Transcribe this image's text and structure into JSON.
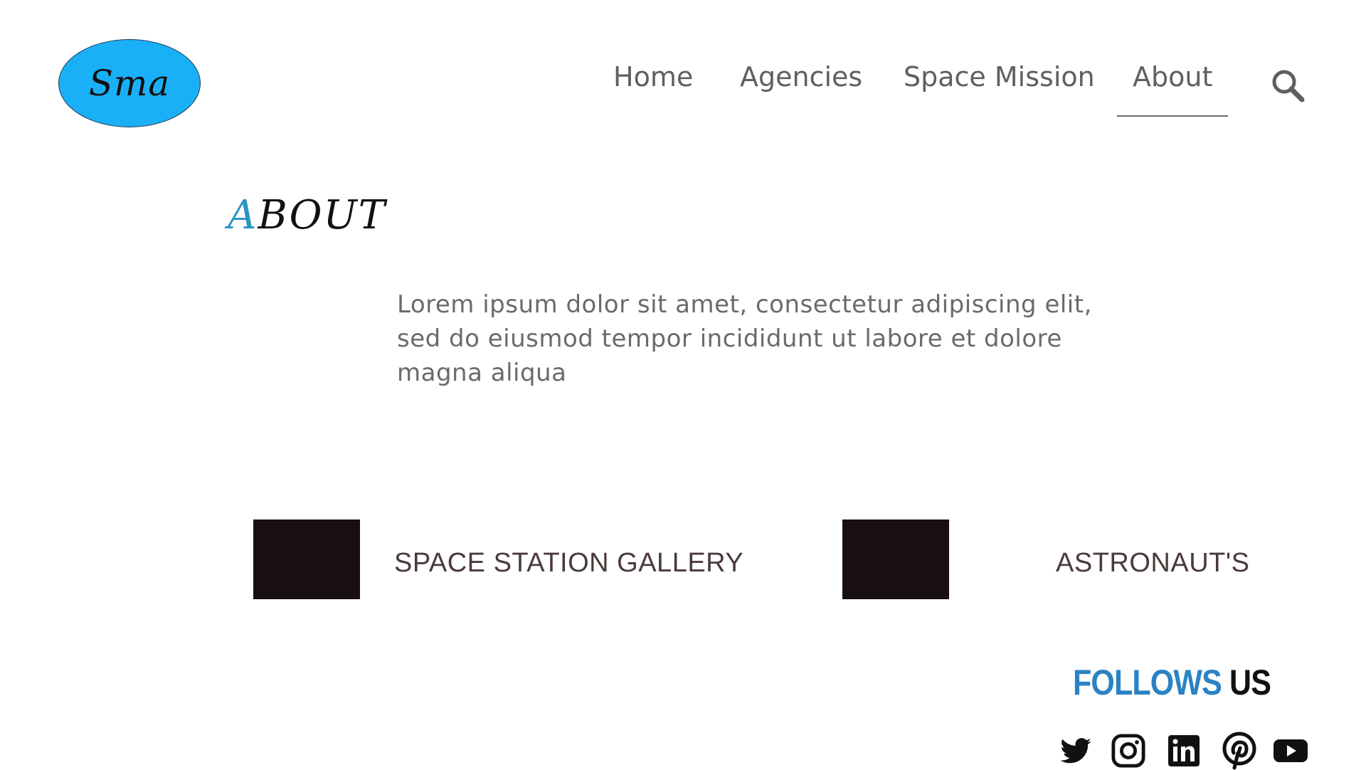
{
  "logo": {
    "text": "Sma",
    "color": "#1ab0f7"
  },
  "nav": {
    "items": [
      {
        "label": "Home"
      },
      {
        "label": "Agencies"
      },
      {
        "label": "Space Mission"
      },
      {
        "label": "About",
        "active": true
      }
    ],
    "search_icon": "search-icon"
  },
  "about": {
    "title_first": "A",
    "title_rest": "BOUT",
    "accent_color": "#2a93c6",
    "body": "Lorem ipsum dolor sit amet, consectetur adipiscing elit, sed do eiusmod tempor incididunt ut labore et dolore magna aliqua"
  },
  "cards": [
    {
      "label": "SPACE STATION GALLERY"
    },
    {
      "label": "ASTRONAUT'S"
    }
  ],
  "follow": {
    "word1": "FOLLOWS",
    "word2": "US",
    "icons": [
      "twitter-icon",
      "instagram-icon",
      "linkedin-icon",
      "pinterest-icon",
      "youtube-icon"
    ]
  }
}
